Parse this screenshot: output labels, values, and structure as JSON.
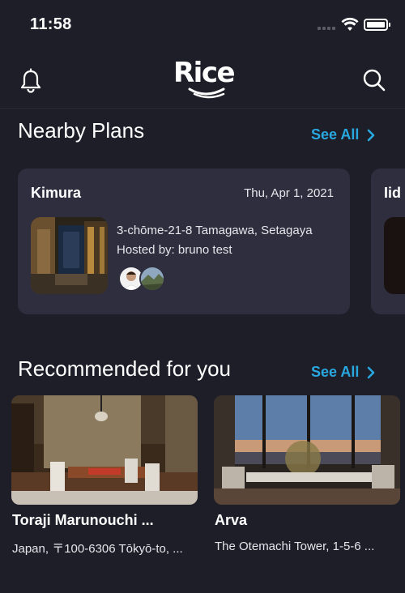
{
  "status_bar": {
    "time": "11:58"
  },
  "header": {
    "logo_text": "Rice"
  },
  "nearby": {
    "title": "Nearby Plans",
    "see_all": "See All",
    "plans": [
      {
        "title": "Kimura",
        "date": "Thu, Apr 1, 2021",
        "address": "3-chōme-21-8 Tamagawa, Setagaya",
        "host": "Hosted by: bruno test"
      },
      {
        "title": "Iid"
      }
    ]
  },
  "recommended": {
    "title": "Recommended for you",
    "see_all": "See All",
    "items": [
      {
        "title": "Toraji Marunouchi ...",
        "subtitle": "Japan, 〒100-6306 Tōkyō-to, ..."
      },
      {
        "title": "Arva",
        "subtitle": "The Otemachi Tower, 1-5-6 ..."
      }
    ]
  },
  "colors": {
    "background": "#1e1e29",
    "card": "#2e2e3f",
    "accent": "#29a8e0",
    "text": "#ffffff"
  },
  "icons": [
    "bell-icon",
    "search-icon",
    "chevron-right-icon",
    "wifi-icon",
    "battery-icon"
  ]
}
